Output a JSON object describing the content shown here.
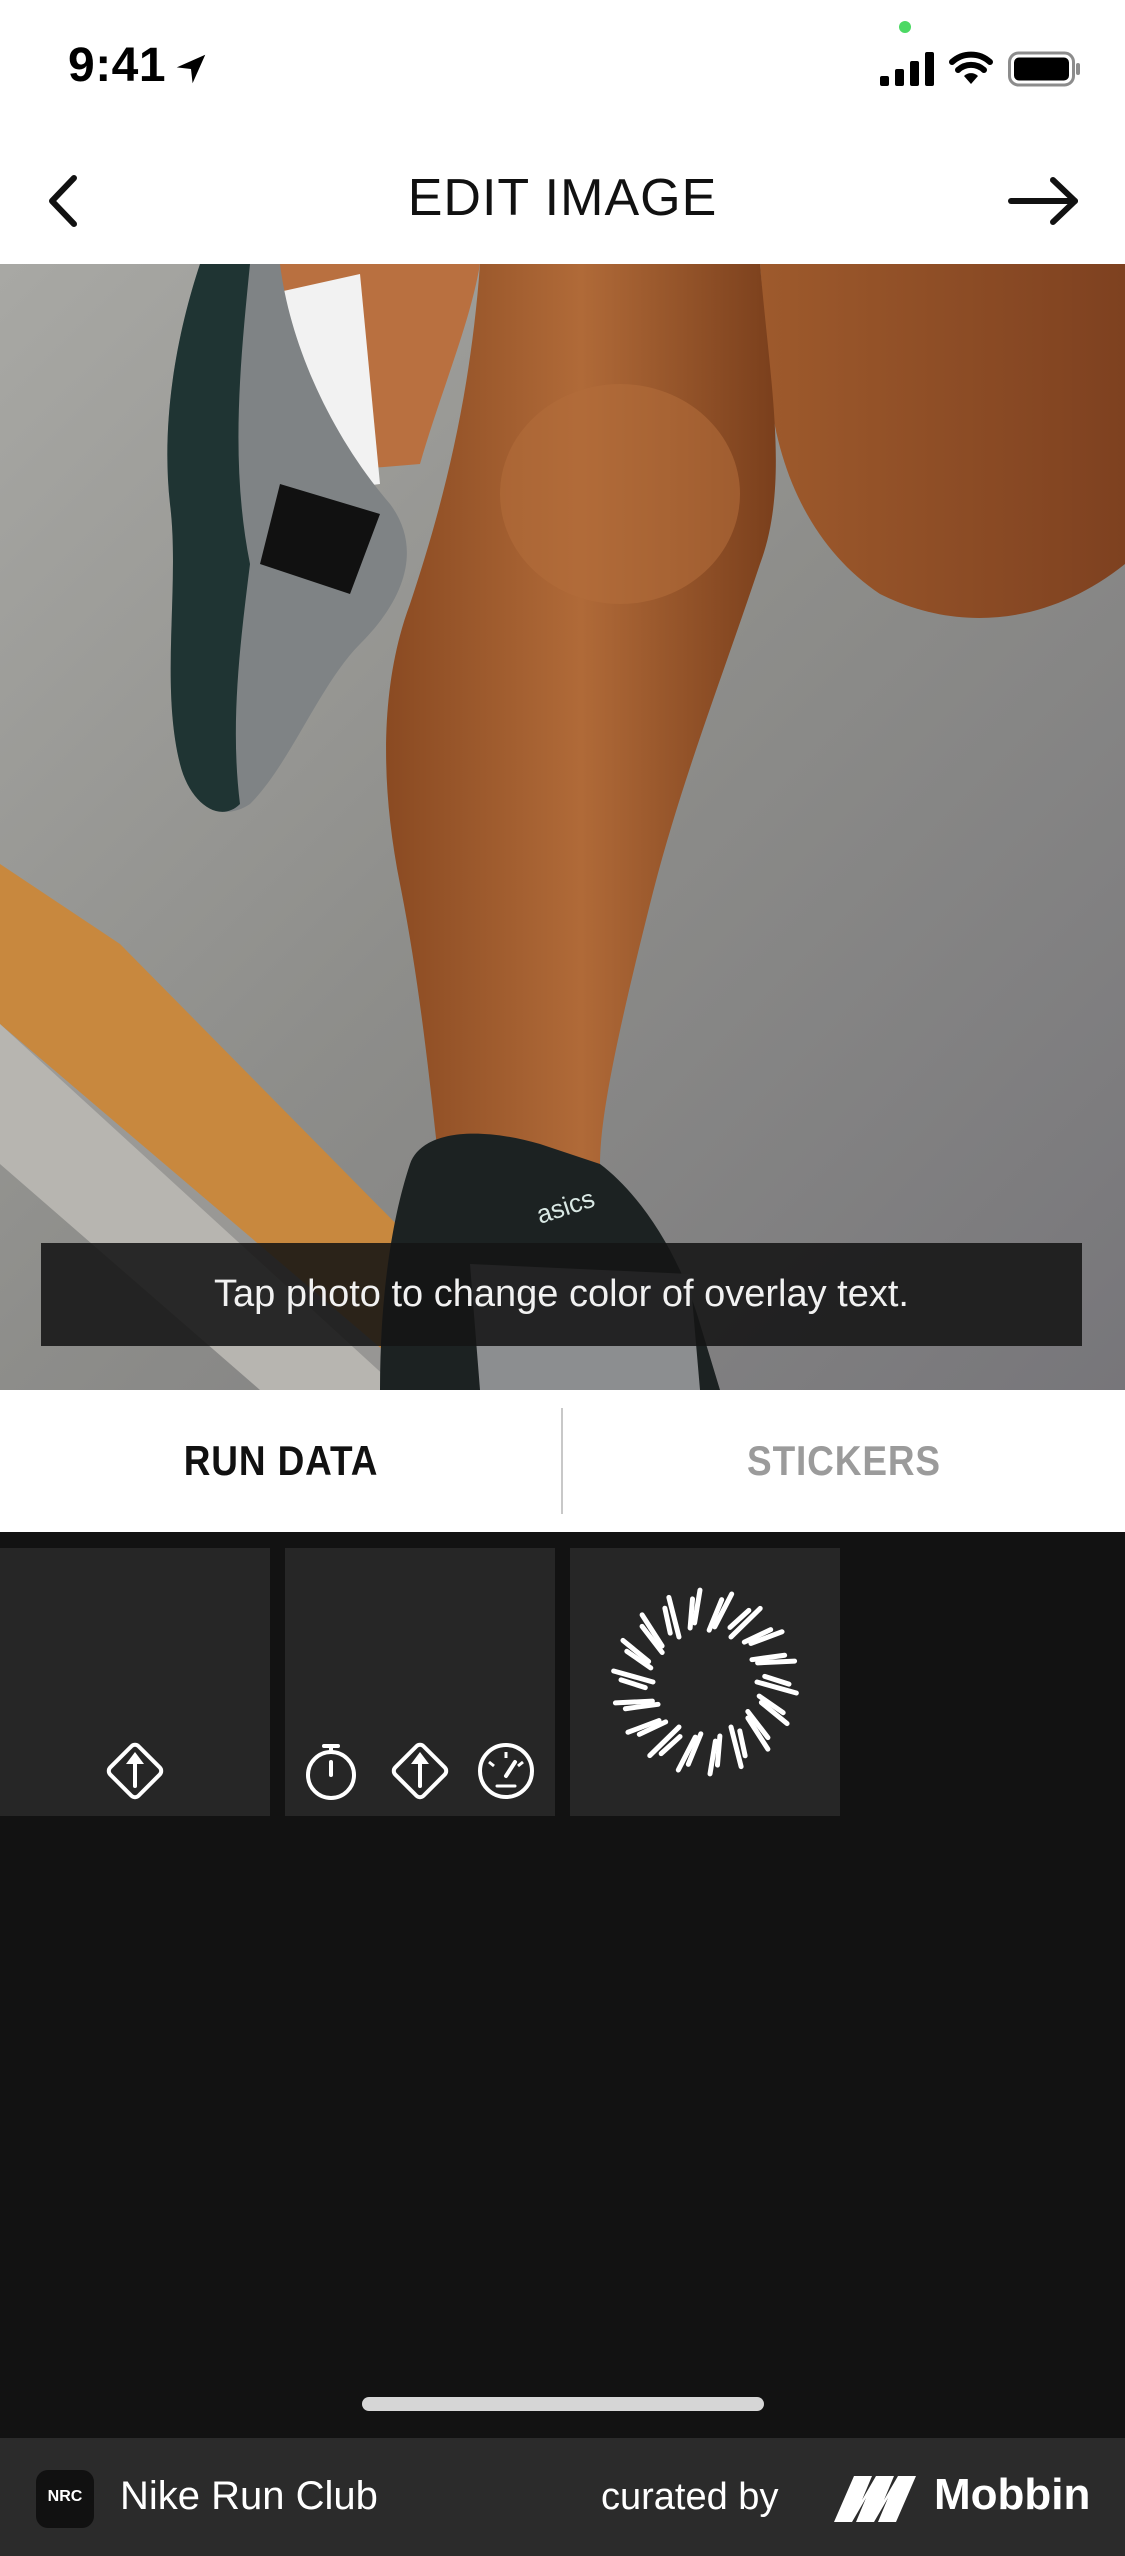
{
  "status_bar": {
    "time": "9:41",
    "icons": [
      "location-arrow-icon",
      "signal-icon",
      "wifi-icon",
      "battery-icon"
    ]
  },
  "nav": {
    "title": "EDIT IMAGE",
    "back_icon": "chevron-left-icon",
    "next_icon": "arrow-right-icon"
  },
  "photo": {
    "hint": "Tap photo to change color of overlay text."
  },
  "tabs": [
    {
      "label": "RUN DATA",
      "active": true
    },
    {
      "label": "STICKERS",
      "active": false
    }
  ],
  "tiles": [
    {
      "icons": [
        "distance-icon"
      ]
    },
    {
      "icons": [
        "stopwatch-icon",
        "distance-icon",
        "pace-gauge-icon"
      ]
    },
    {
      "icons": [
        "sunburst-icon"
      ]
    }
  ],
  "footer": {
    "app_name": "Nike Run Club",
    "app_logo_text": "NRC",
    "curated_by": "curated by",
    "brand": "Mobbin"
  },
  "colors": {
    "nav_background": "#ffffff",
    "tiles_background": "#121212",
    "tile": "#262626",
    "tab_active": "#111111",
    "tab_inactive": "#9b9b9b",
    "footer": "#2b2b2b"
  }
}
